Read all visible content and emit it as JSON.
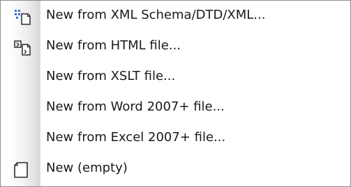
{
  "menu": {
    "items": [
      {
        "label": "New from XML Schema/DTD/XML...",
        "icon": "schema-tree-document-icon"
      },
      {
        "label": "New from HTML file...",
        "icon": "html-convert-document-icon"
      },
      {
        "label": "New from XSLT file...",
        "icon": ""
      },
      {
        "label": "New from Word 2007+ file...",
        "icon": ""
      },
      {
        "label": "New from Excel 2007+ file...",
        "icon": ""
      },
      {
        "label": "New (empty)",
        "icon": "blank-document-icon"
      }
    ]
  },
  "colors": {
    "menu_border": "#8c8c8c",
    "gutter": "#e4e4e4",
    "text": "#1a1a1a",
    "icon_stroke": "#2b2b2b",
    "icon_accent": "#3a6fd8"
  }
}
